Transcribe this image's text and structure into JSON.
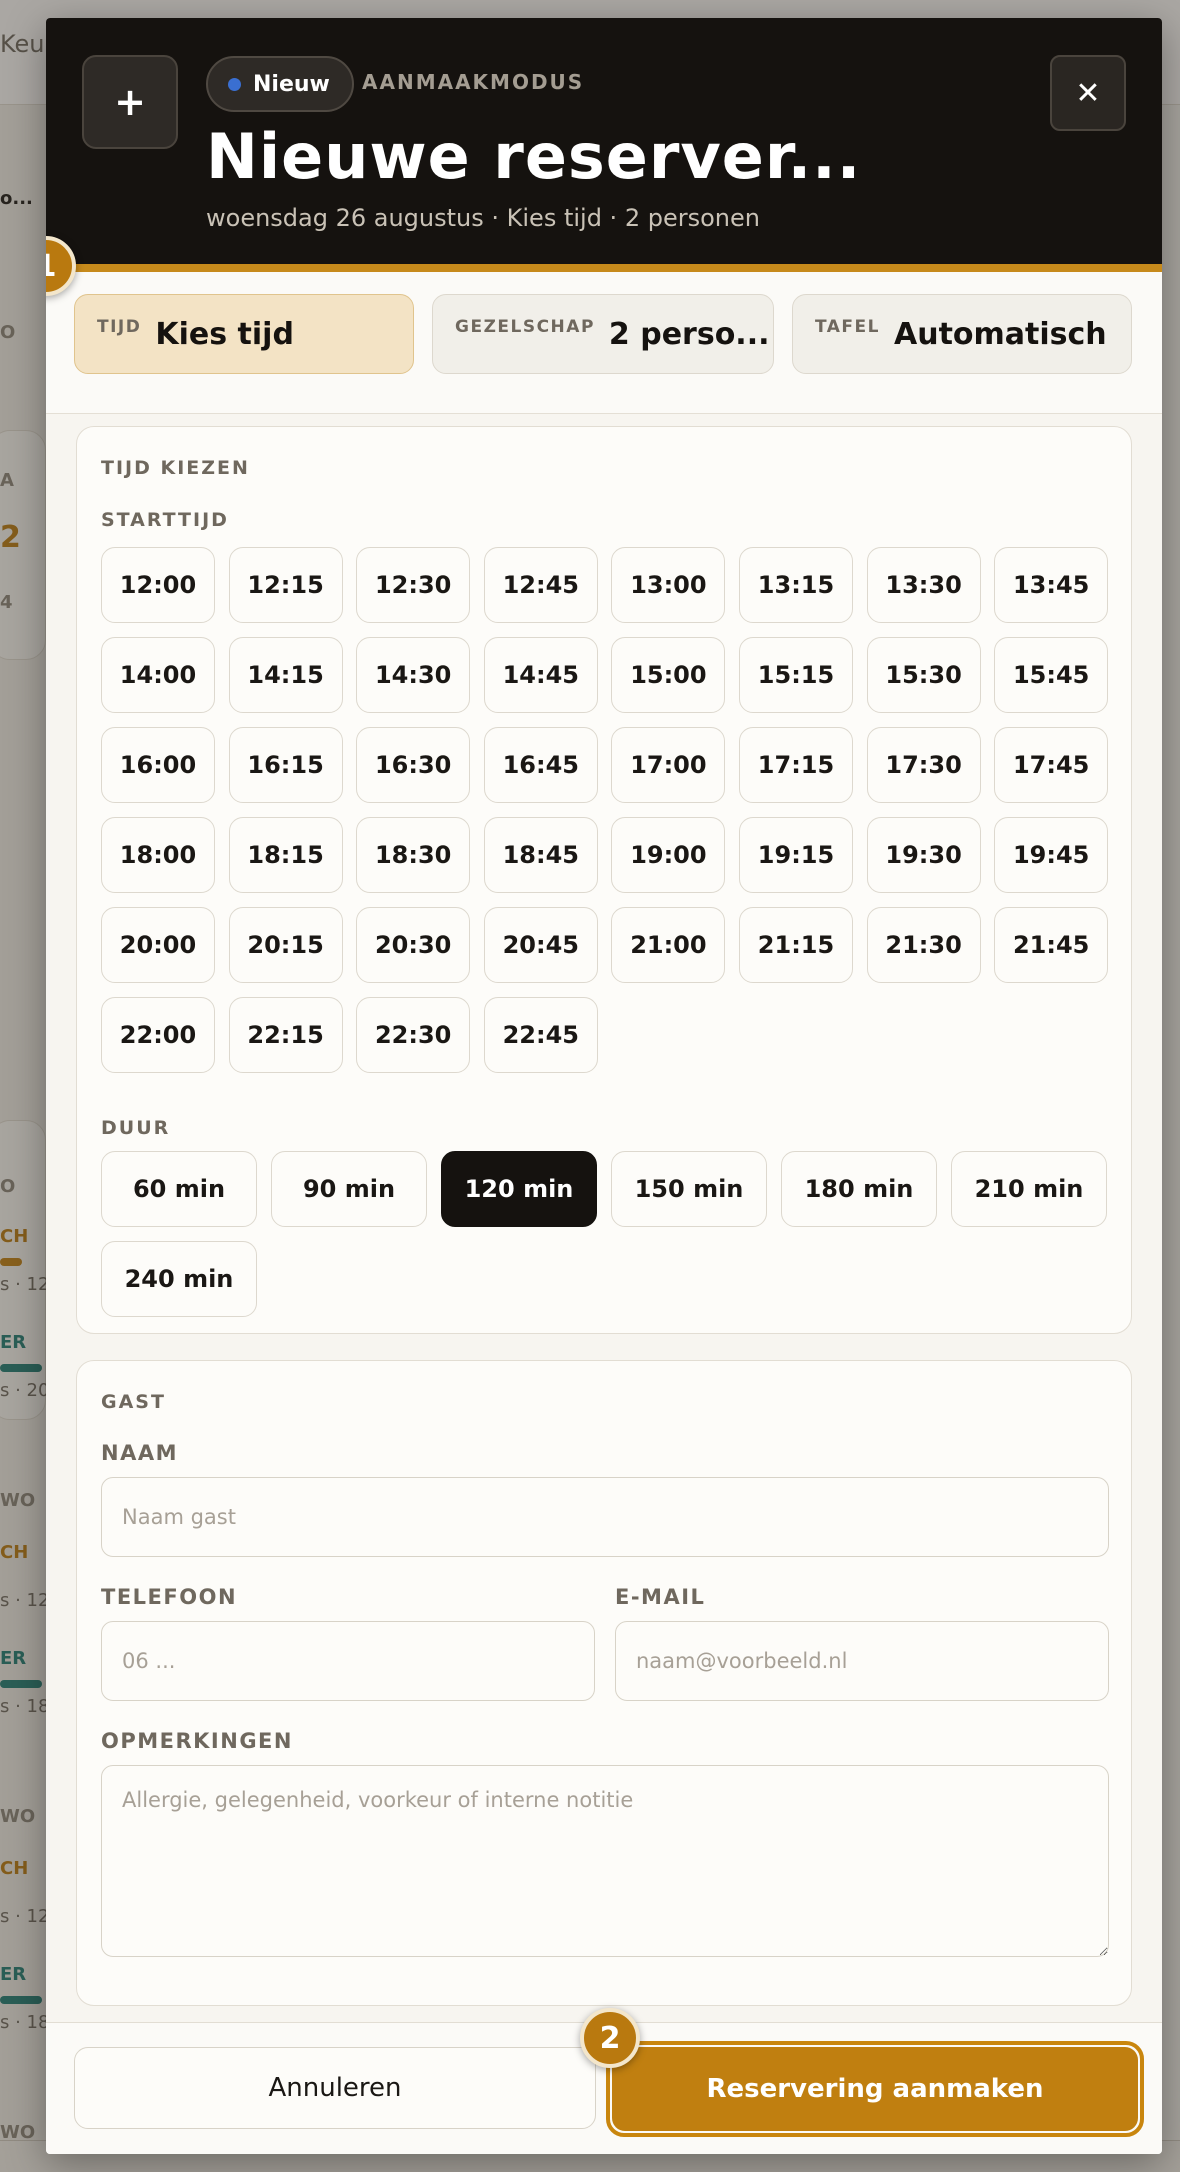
{
  "background": {
    "brand_fragment": "Keu",
    "fragments": [
      "o...",
      "O",
      "A",
      "2",
      "4",
      "O",
      "CH",
      "s · 12:",
      "ER",
      "s · 20",
      "WO",
      "CH",
      "s · 12:",
      "ER",
      "s · 18:",
      "WO",
      "CH",
      "s · 12:",
      "ER",
      "s · 18:",
      "WO"
    ]
  },
  "modal": {
    "plus_label": "+",
    "badge_label": "Nieuw",
    "mode_label": "AANMAAKMODUS",
    "title": "Nieuwe reserver...",
    "subtitle": "woensdag 26 augustus · Kies tijd · 2 personen",
    "close_label": "✕",
    "steps": [
      "1",
      "2"
    ],
    "tabs": [
      {
        "key": "TIJD",
        "value": "Kies tijd"
      },
      {
        "key": "GEZELSCHAP",
        "value": "2 perso..."
      },
      {
        "key": "TAFEL",
        "value": "Automatisch"
      }
    ],
    "time_section": {
      "title": "TIJD KIEZEN",
      "start_label": "STARTTIJD",
      "times": [
        "12:00",
        "12:15",
        "12:30",
        "12:45",
        "13:00",
        "13:15",
        "13:30",
        "13:45",
        "14:00",
        "14:15",
        "14:30",
        "14:45",
        "15:00",
        "15:15",
        "15:30",
        "15:45",
        "16:00",
        "16:15",
        "16:30",
        "16:45",
        "17:00",
        "17:15",
        "17:30",
        "17:45",
        "18:00",
        "18:15",
        "18:30",
        "18:45",
        "19:00",
        "19:15",
        "19:30",
        "19:45",
        "20:00",
        "20:15",
        "20:30",
        "20:45",
        "21:00",
        "21:15",
        "21:30",
        "21:45",
        "22:00",
        "22:15",
        "22:30",
        "22:45"
      ],
      "duration_label": "DUUR",
      "durations": [
        "60 min",
        "90 min",
        "120 min",
        "150 min",
        "180 min",
        "210 min",
        "240 min"
      ],
      "selected_duration": "120 min"
    },
    "guest_section": {
      "title": "GAST",
      "name_label": "NAAM",
      "name_placeholder": "Naam gast",
      "phone_label": "TELEFOON",
      "phone_placeholder": "06 ...",
      "email_label": "E-MAIL",
      "email_placeholder": "naam@voorbeeld.nl",
      "notes_label": "OPMERKINGEN",
      "notes_placeholder": "Allergie, gelegenheid, voorkeur of interne notitie"
    },
    "footer": {
      "cancel_label": "Annuleren",
      "create_label": "Reservering aanmaken"
    }
  },
  "colors": {
    "accent": "#c07f10",
    "header_bg": "#15120f",
    "active_tab_bg": "#f3e3c5",
    "badge_dot": "#3a6fd1"
  }
}
